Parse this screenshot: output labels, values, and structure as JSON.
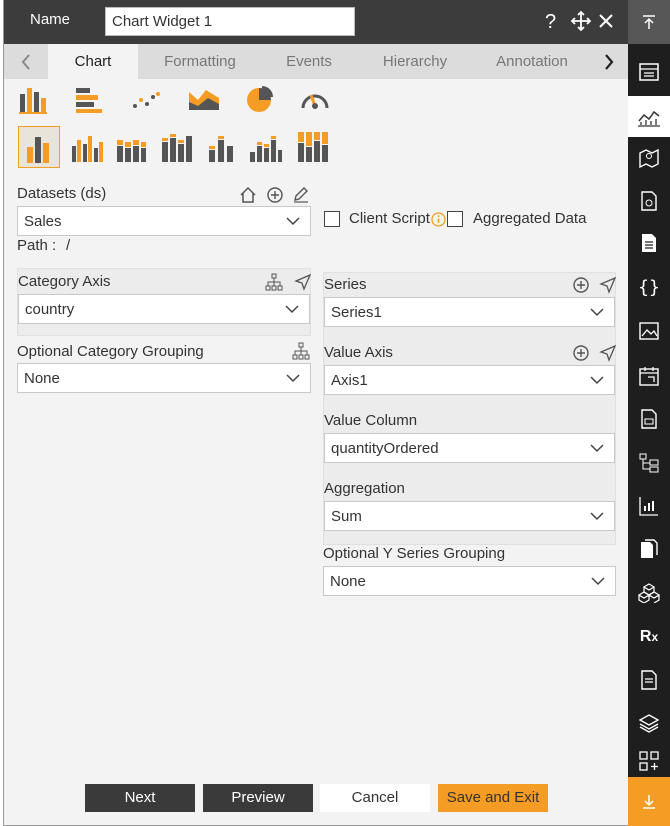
{
  "header": {
    "name_label": "Name",
    "name_value": "Chart Widget 1",
    "help_icon": "question-icon",
    "move_icon": "move-icon",
    "close_icon": "close-icon"
  },
  "tabs": [
    {
      "label": "Chart",
      "active": true
    },
    {
      "label": "Formatting",
      "active": false
    },
    {
      "label": "Events",
      "active": false
    },
    {
      "label": "Hierarchy",
      "active": false
    },
    {
      "label": "Annotation",
      "active": false
    }
  ],
  "chart_types": [
    "column-chart-icon",
    "bar-chart-icon",
    "scatter-chart-icon",
    "area-chart-icon",
    "pie-chart-icon",
    "gauge-chart-icon"
  ],
  "chart_variants": [
    "clustered-column-icon",
    "grouped-column-icon",
    "stacked-column-icon",
    "tall-stacked-column-icon",
    "simple-column-icon",
    "small-stacked-column-icon",
    "full-stacked-column-icon"
  ],
  "datasets": {
    "label": "Datasets (ds)",
    "value": "Sales",
    "path_label": "Path :",
    "path_value": "/"
  },
  "client_script": {
    "label": "Client Script",
    "checked": false
  },
  "aggregated_data": {
    "label": "Aggregated Data",
    "checked": false
  },
  "category_axis": {
    "label": "Category Axis",
    "value": "country"
  },
  "optional_category_grouping": {
    "label": "Optional Category Grouping",
    "value": "None"
  },
  "series": {
    "label": "Series",
    "value": "Series1"
  },
  "value_axis": {
    "label": "Value Axis",
    "value": "Axis1"
  },
  "value_column": {
    "label": "Value Column",
    "value": "quantityOrdered"
  },
  "aggregation": {
    "label": "Aggregation",
    "value": "Sum"
  },
  "optional_y_series_grouping": {
    "label": "Optional Y Series Grouping",
    "value": "None"
  },
  "footer": {
    "next": "Next",
    "preview": "Preview",
    "cancel": "Cancel",
    "save_exit": "Save and Exit"
  },
  "sidebar": [
    "scroll-top-icon",
    "widget-list-icon",
    "chart-line-icon",
    "map-icon",
    "document-settings-icon",
    "document-icon",
    "braces-icon",
    "image-icon",
    "calendar-icon",
    "report-icon",
    "hierarchy-icon",
    "bar-chart-small-icon",
    "copy-icon",
    "cubes-icon",
    "rx-icon",
    "notes-icon",
    "layers-icon",
    "add-widget-icon",
    "scroll-bottom-icon"
  ],
  "colors": {
    "accent": "#f59c24",
    "dark": "#3c3c3c",
    "icon_gray": "#555555"
  }
}
